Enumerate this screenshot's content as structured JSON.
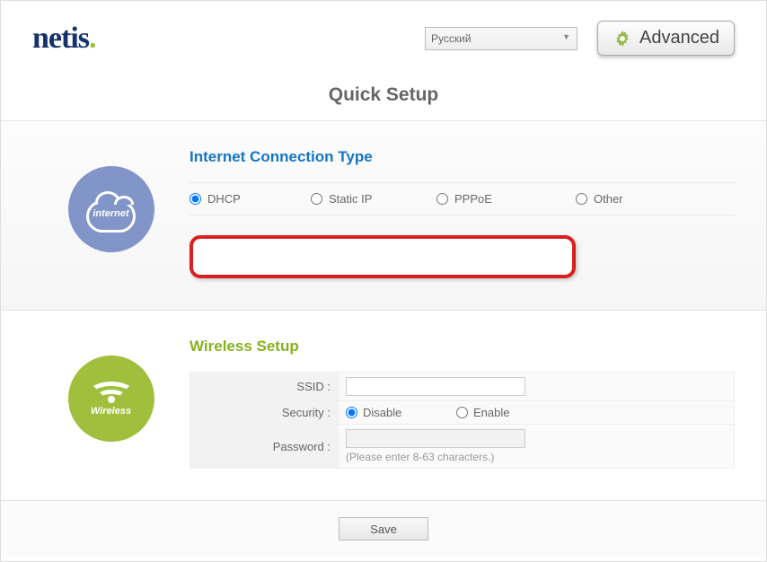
{
  "header": {
    "logo": "netis",
    "language": "Русский",
    "advanced_label": "Advanced"
  },
  "page_title": "Quick Setup",
  "internet": {
    "title": "Internet Connection Type",
    "icon_label": "internet",
    "options": [
      "DHCP",
      "Static IP",
      "PPPoE",
      "Other"
    ],
    "selected": "DHCP"
  },
  "wireless": {
    "title": "Wireless Setup",
    "icon_label": "Wireless",
    "ssid_label": "SSID :",
    "ssid_value": "",
    "security_label": "Security :",
    "security_options": {
      "disable": "Disable",
      "enable": "Enable"
    },
    "security_selected": "disable",
    "password_label": "Password :",
    "password_value": "",
    "password_hint": "(Please enter 8-63 characters.)"
  },
  "footer": {
    "save_label": "Save"
  }
}
